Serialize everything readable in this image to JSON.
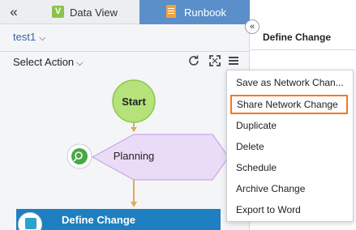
{
  "tabs": {
    "collapse_icon": "«",
    "data_view": {
      "label": "Data View",
      "icon_letter": "V"
    },
    "runbook": {
      "label": "Runbook"
    }
  },
  "runbook": {
    "name": "test1",
    "chevron": "⌵",
    "select_action": "Select Action",
    "select_chevron": "⌵"
  },
  "toolbar_icons": [
    "refresh-icon",
    "fullscreen-icon",
    "menu-icon"
  ],
  "expand_icon": "«",
  "right_panel": {
    "title": "Define Change"
  },
  "flow": {
    "start": "Start",
    "planning": "Planning",
    "current_step": "Define Change"
  },
  "menu": {
    "items": [
      "Save as Network Chan...",
      "Share Network Change",
      "Duplicate",
      "Delete",
      "Schedule",
      "Archive Change",
      "Export to Word"
    ]
  },
  "colors": {
    "accent_tab": "#5b8fc9",
    "start_node": "#b5e27a",
    "planning_node": "#eadcf7",
    "current_step": "#1e7fc1",
    "highlight": "#f07a24",
    "connector": "#e3a85a"
  }
}
